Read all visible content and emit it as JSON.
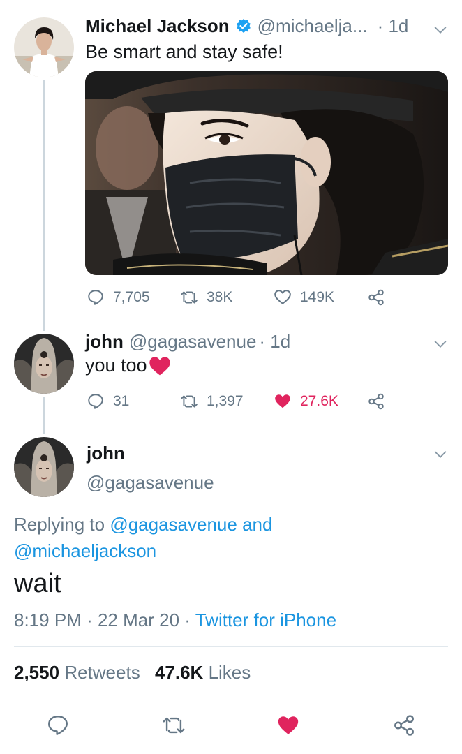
{
  "tweet1": {
    "name": "Michael Jackson",
    "handle": "@michaelja...",
    "time": "· 1d",
    "text": "Be smart and stay safe!",
    "media_icon": "photo-masked-man",
    "stats": {
      "replies": "7,705",
      "retweets": "38K",
      "likes": "149K"
    }
  },
  "tweet2": {
    "name": "john",
    "handle": "@gagasavenue",
    "time": "· 1d",
    "text": "you too",
    "emoji": "❤️",
    "stats": {
      "replies": "31",
      "retweets": "1,397",
      "likes": "27.6K"
    }
  },
  "main_tweet": {
    "name": "john",
    "handle": "@gagasavenue",
    "replying_label": "Replying to",
    "reply_to_1": "@gagasavenue",
    "reply_and": "and",
    "reply_to_2": "@michaeljackson",
    "text": "wait",
    "time": "8:19 PM",
    "date": "22 Mar 20",
    "client": "Twitter for iPhone",
    "retweet_count": "2,550",
    "retweets_label": "Retweets",
    "like_count": "47.6K",
    "likes_label": "Likes"
  },
  "colors": {
    "link_blue": "#1b95e0",
    "like_red": "#e0245e",
    "muted_grey": "#657786",
    "verified_blue": "#1da1f2"
  }
}
